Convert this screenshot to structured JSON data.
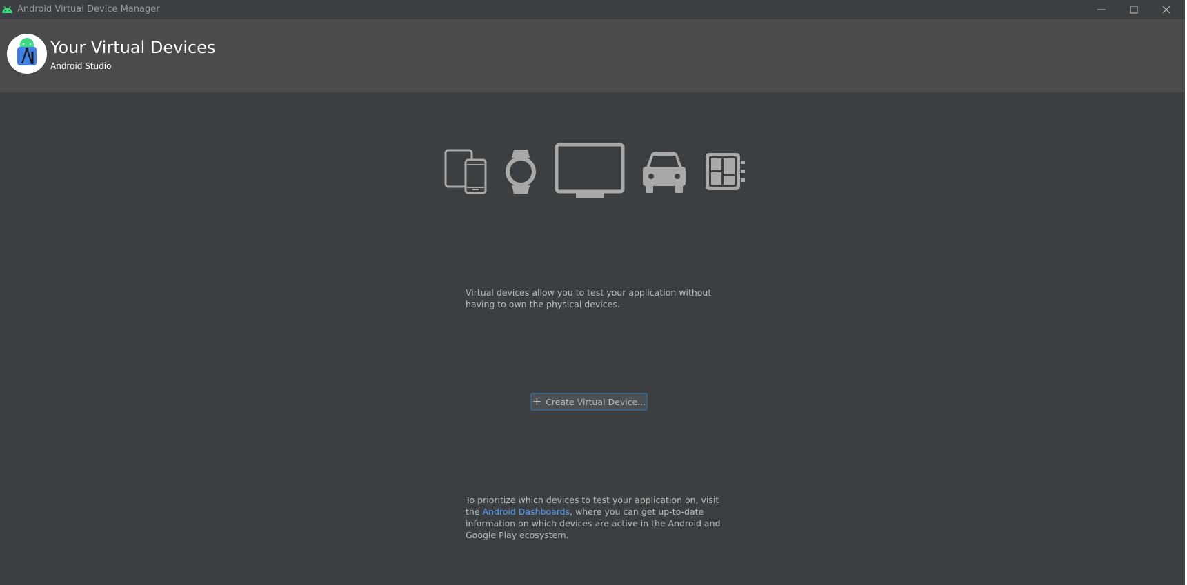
{
  "window": {
    "title": "Android Virtual Device Manager",
    "app_icon": "android-icon"
  },
  "header": {
    "title": "Your Virtual Devices",
    "subtitle": "Android Studio",
    "logo_icon": "android-studio-logo-icon"
  },
  "device_types": [
    {
      "name": "phone-tablet-icon"
    },
    {
      "name": "watch-icon"
    },
    {
      "name": "tv-icon"
    },
    {
      "name": "car-icon"
    },
    {
      "name": "things-icon"
    }
  ],
  "description": "Virtual devices allow you to test your application without having to own the physical devices.",
  "create_button": {
    "icon": "plus-icon",
    "label": "Create Virtual Device..."
  },
  "footer": {
    "before_link": "To prioritize which devices to test your application on, visit the ",
    "link_text": "Android Dashboards",
    "after_link": ", where you can get up-to-date information on which devices are active in the Android and Google Play ecosystem."
  },
  "colors": {
    "background": "#3c3f41",
    "header_bg": "#4b4b4b",
    "text": "#bbbbbb",
    "link": "#589df6",
    "button_border": "#3d6185",
    "android_green": "#3ddc84"
  }
}
